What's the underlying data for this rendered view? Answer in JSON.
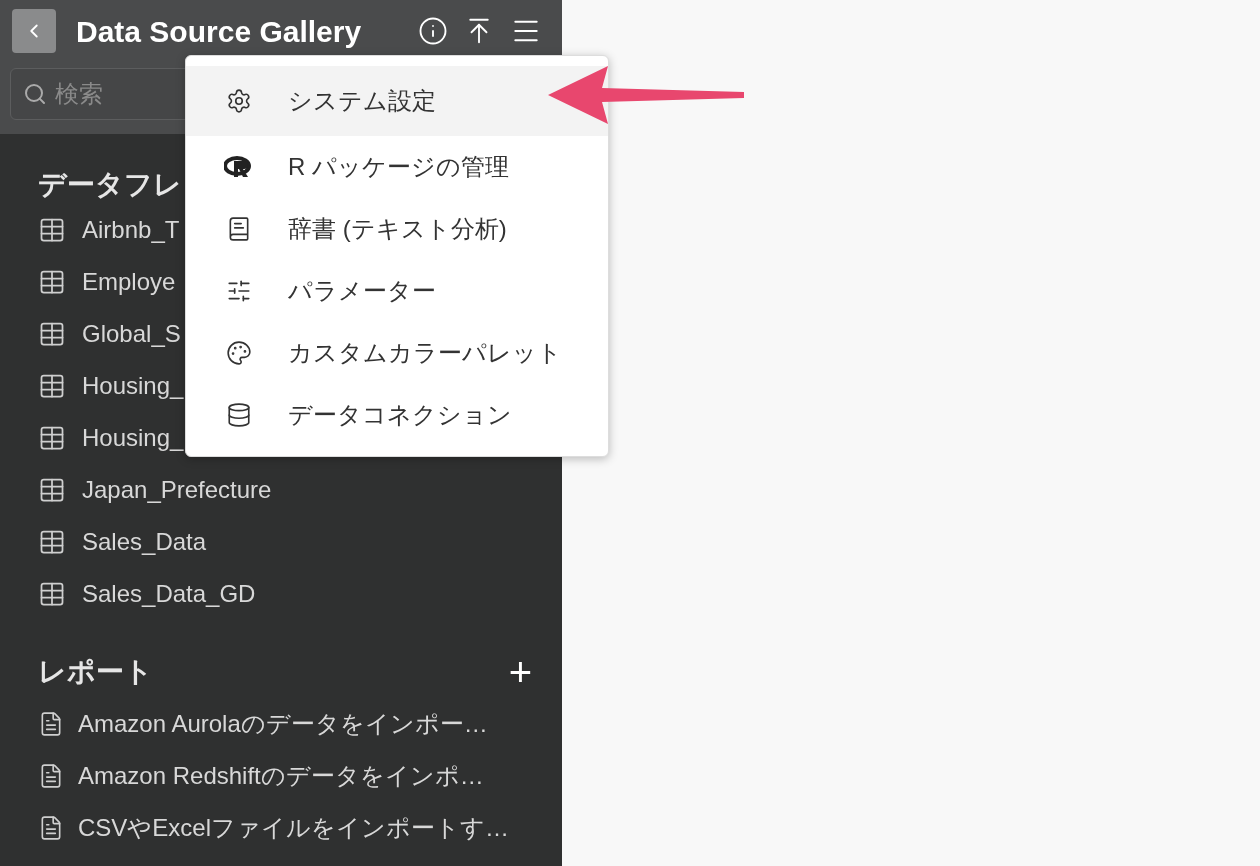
{
  "header": {
    "title": "Data Source Gallery"
  },
  "search": {
    "placeholder": "検索"
  },
  "dataframes": {
    "heading": "データフレ",
    "items": [
      {
        "label": "Airbnb_T"
      },
      {
        "label": "Employe"
      },
      {
        "label": "Global_S"
      },
      {
        "label": "Housing_"
      },
      {
        "label": "Housing_"
      },
      {
        "label": "Japan_Prefecture"
      },
      {
        "label": "Sales_Data"
      },
      {
        "label": "Sales_Data_GD"
      }
    ]
  },
  "reports": {
    "heading": "レポート",
    "add": "+",
    "items": [
      {
        "label": "Amazon Aurolaのデータをインポー…"
      },
      {
        "label": "Amazon Redshiftのデータをインポ…"
      },
      {
        "label": "CSVやExcelファイルをインポートす…"
      }
    ]
  },
  "menu": {
    "items": [
      {
        "kind": "gear",
        "label": "システム設定",
        "highlighted": true
      },
      {
        "kind": "r",
        "label": "R パッケージの管理",
        "highlighted": false
      },
      {
        "kind": "book",
        "label": "辞書 (テキスト分析)",
        "highlighted": false
      },
      {
        "kind": "sliders",
        "label": "パラメーター",
        "highlighted": false
      },
      {
        "kind": "palette",
        "label": "カスタムカラーパレット",
        "highlighted": false
      },
      {
        "kind": "database",
        "label": "データコネクション",
        "highlighted": false
      }
    ]
  }
}
